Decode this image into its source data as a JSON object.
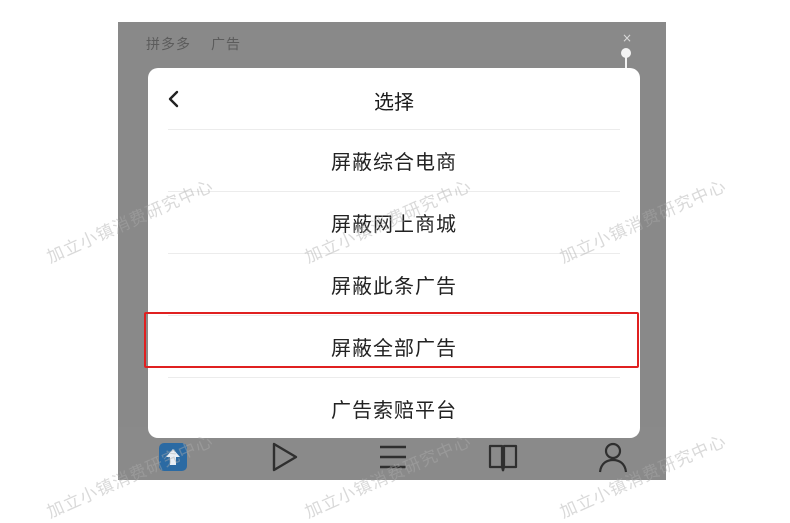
{
  "ad_header": {
    "brand": "拼多多",
    "tag": "广告",
    "close_glyph": "×"
  },
  "modal": {
    "title": "选择",
    "options": [
      {
        "label": "屏蔽综合电商"
      },
      {
        "label": "屏蔽网上商城"
      },
      {
        "label": "屏蔽此条广告"
      },
      {
        "label": "屏蔽全部广告",
        "highlighted": true
      },
      {
        "label": "广告索赔平台"
      }
    ]
  },
  "tabbar": {
    "items": [
      "home-icon",
      "play-icon",
      "menu-icon",
      "book-icon",
      "profile-icon"
    ]
  },
  "watermark": {
    "text": "加立小镇消费研究中心"
  },
  "colors": {
    "highlight_border": "#e02020",
    "home_accent": "#2b6aa3",
    "overlay": "#898989"
  }
}
